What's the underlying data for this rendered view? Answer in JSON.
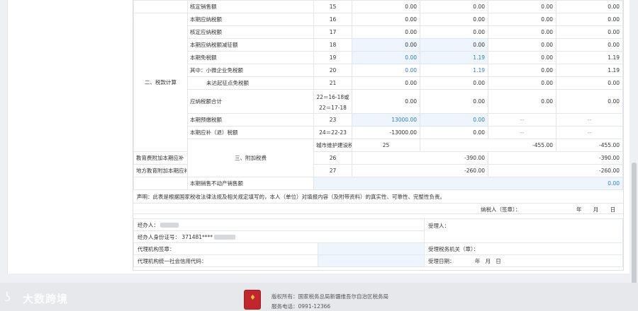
{
  "rows": [
    {
      "section": "",
      "item": "核定销售额",
      "line": "15",
      "v1": "0.00",
      "v2": "0.00",
      "v3": "0.00",
      "v4": "0.00"
    },
    {
      "section": "",
      "item": "本期应纳税额",
      "line": "16",
      "v1": "0.00",
      "v2": "0.00",
      "v3": "0.00",
      "v4": "0.00"
    },
    {
      "section": "",
      "item": "核定应纳税额",
      "line": "17",
      "v1": "0.00",
      "v2": "0.00",
      "v3": "0.00",
      "v4": "0.00"
    },
    {
      "section": "",
      "item": "本期应纳税额减征额",
      "line": "18",
      "v1": "0.00",
      "v2": "0.00",
      "v3": "0.00",
      "v4": "0.00"
    },
    {
      "section": "",
      "item": "本期免税额",
      "line": "19",
      "v1": "0.00",
      "v2": "1.19",
      "v3": "0.00",
      "v4": "1.19"
    },
    {
      "section": "二、税款计算",
      "item": "其中：小微企业免税额",
      "line": "20",
      "v1": "0.00",
      "v2": "1.19",
      "v3": "0.00",
      "v4": "1.19"
    },
    {
      "section": "",
      "item": "未达起征点免税额",
      "line": "21",
      "v1": "0.00",
      "v2": "0.00",
      "v3": "0.00",
      "v4": "0.00"
    },
    {
      "section": "",
      "item": "应纳税额合计",
      "line": "22＝16-18或",
      "line2": "22＝17-18",
      "v1": "0.00",
      "v2": "0.00",
      "v3": "0.00",
      "v4": "0.00"
    },
    {
      "section": "",
      "item": "本期预缴税额",
      "line": "23",
      "v1": "13000.00",
      "v2": "0.00",
      "v3": "--",
      "v4": "--"
    },
    {
      "section": "",
      "item": "本期应补（退）税额",
      "line": "24＝22-23",
      "v1": "-13000.00",
      "v2": "0.00",
      "v3": "--",
      "v4": "--"
    }
  ],
  "surtax": {
    "section": "三、附加税费",
    "rows": [
      {
        "item": "城市维护建设税本期应补（退）税额",
        "line": "25",
        "v_a": "-455.00",
        "v_b": "-455.00"
      },
      {
        "item": "教育费附加本期应补（退）费额",
        "line": "26",
        "v_a": "-390.00",
        "v_b": "-390.00"
      },
      {
        "item": "地方教育附加本期应补（退）费额",
        "line": "27",
        "v_a": "-260.00",
        "v_b": "-260.00"
      }
    ]
  },
  "realestate": {
    "item": "本期销售不动产销售额",
    "value": "0.00"
  },
  "declaration": "声明：此表是根据国家税收法律法规及相关规定填写的，本人（单位）对填报内容（及附带资料）的真实性、可靠性、完整性负责。",
  "signature": {
    "taxpayer_label": "纳税人（签章）：",
    "date_label": "年 月 日"
  },
  "agent": {
    "handler_label": "经办人：",
    "id_label": "经办人身份证号：",
    "id_value": "371481****",
    "agency_label": "代理机构签章：",
    "agency_code_label": "代理机构统一社会信用代码：",
    "receiver_label": "受理人：",
    "receiver_office_label": "受理税务机关（章）：",
    "receive_date_label": "受理日期：",
    "receive_date_ymd": "年   月   日"
  },
  "footer": {
    "copyright": "版权所有：国家税务总局新疆维吾尔自治区税务局",
    "phone": "服务电话：0991-12366"
  },
  "watermark": {
    "text": "大数跨境"
  },
  "colors": {
    "accent_blue": "#2f7fd0",
    "input_bg": "#eef5fd"
  }
}
